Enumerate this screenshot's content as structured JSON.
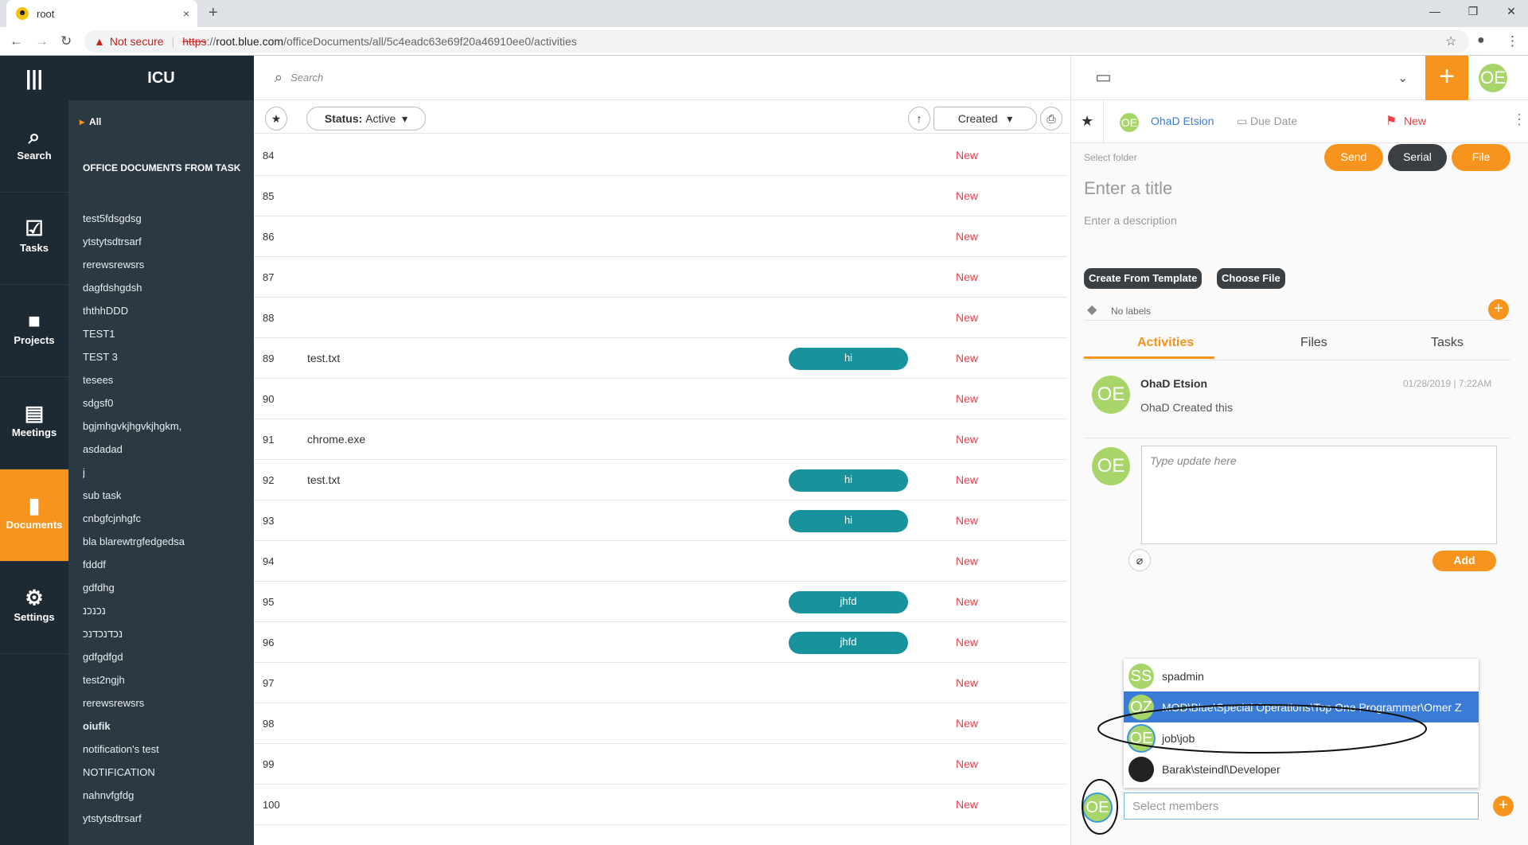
{
  "browser": {
    "tab_title": "root",
    "tab_close": "×",
    "new_tab": "+",
    "not_secure": "Not secure",
    "url_protocol": "https",
    "url_sep": "://",
    "url_host": "root.blue.com",
    "url_path": "/officeDocuments/all/5c4eadc63e69f20a46910ee0/activities"
  },
  "rail": {
    "items": [
      {
        "label": "Search",
        "icon": "search-icon"
      },
      {
        "label": "Tasks",
        "icon": "checkbox-icon"
      },
      {
        "label": "Projects",
        "icon": "briefcase-icon"
      },
      {
        "label": "Meetings",
        "icon": "chat-icon"
      },
      {
        "label": "Documents",
        "icon": "document-icon",
        "active": true
      },
      {
        "label": "Settings",
        "icon": "gear-icon"
      }
    ]
  },
  "folders": {
    "app_title": "ICU",
    "all_label": "All",
    "heading": "OFFICE DOCUMENTS FROM TASK",
    "items": [
      "test5fdsgdsg",
      "ytstytsdtrsarf",
      " rerewsrewsrs",
      "dagfdshgdsh",
      "ththhDDD",
      "TEST1",
      "TEST 3",
      "tesees",
      "sdgsf0",
      "bgjmhgvkjhgvkjhgkm,",
      "asdadad",
      "j",
      "sub task",
      "cnbgfcjnhgfc",
      "bla blarewtrgfedgedsa",
      "fdddf",
      "gdfdhg",
      "נכנכנ",
      "נכדנכדנכ",
      "gdfgdfgd",
      "test2ngjh",
      " rerewsrewsrs",
      "oiufik",
      "notification's test",
      "NOTIFICATION",
      "nahnvfgfdg",
      "ytstytsdtrsarf"
    ]
  },
  "main": {
    "search_placeholder": "Search",
    "status_label": "Status:",
    "status_value": "Active",
    "sort_value": "Created",
    "rows": [
      {
        "num": "84",
        "title": "",
        "tag": "",
        "status": "New"
      },
      {
        "num": "85",
        "title": "",
        "tag": "",
        "status": "New"
      },
      {
        "num": "86",
        "title": "",
        "tag": "",
        "status": "New"
      },
      {
        "num": "87",
        "title": "",
        "tag": "",
        "status": "New"
      },
      {
        "num": "88",
        "title": "",
        "tag": "",
        "status": "New"
      },
      {
        "num": "89",
        "title": "test.txt",
        "tag": "hi",
        "status": "New"
      },
      {
        "num": "90",
        "title": "",
        "tag": "",
        "status": "New"
      },
      {
        "num": "91",
        "title": "chrome.exe",
        "tag": "",
        "status": "New"
      },
      {
        "num": "92",
        "title": "test.txt",
        "tag": "hi",
        "status": "New"
      },
      {
        "num": "93",
        "title": "",
        "tag": "hi",
        "status": "New"
      },
      {
        "num": "94",
        "title": "",
        "tag": "",
        "status": "New"
      },
      {
        "num": "95",
        "title": "",
        "tag": "jhfd",
        "status": "New"
      },
      {
        "num": "96",
        "title": "",
        "tag": "jhfd",
        "status": "New"
      },
      {
        "num": "97",
        "title": "",
        "tag": "",
        "status": "New"
      },
      {
        "num": "98",
        "title": "",
        "tag": "",
        "status": "New"
      },
      {
        "num": "99",
        "title": "",
        "tag": "",
        "status": "New"
      },
      {
        "num": "100",
        "title": "",
        "tag": "",
        "status": "New"
      }
    ]
  },
  "detail": {
    "user_initials": "OE",
    "assignee_name": "OhaD Etsion",
    "due_date": "Due Date",
    "status_flag": "New",
    "select_folder": "Select folder",
    "send": "Send",
    "serial": "Serial",
    "file": "File",
    "title_placeholder": "Enter a title",
    "desc_placeholder": "Enter a description",
    "create_template": "Create From Template",
    "choose_file": "Choose File",
    "no_labels": "No labels",
    "tabs": [
      "Activities",
      "Files",
      "Tasks"
    ],
    "activity": {
      "name": "OhaD Etsion",
      "time": "01/28/2019 | 7:22AM",
      "text": "OhaD Created this"
    },
    "update_placeholder": "Type update here",
    "add": "Add",
    "members": [
      {
        "initials": "SS",
        "name": "spadmin"
      },
      {
        "initials": "OZ",
        "name": "MOD\\Blue\\Special Operations\\Top One Programmer\\Omer Z"
      },
      {
        "initials": "OE",
        "name": "job\\job"
      },
      {
        "initials": "",
        "name": "Barak\\steindl\\Developer"
      }
    ],
    "members_placeholder": "Select members"
  },
  "colors": {
    "accent": "#f7941d",
    "teal": "#18929c",
    "status_red": "#e8404a",
    "avatar": "#a8d56a"
  }
}
